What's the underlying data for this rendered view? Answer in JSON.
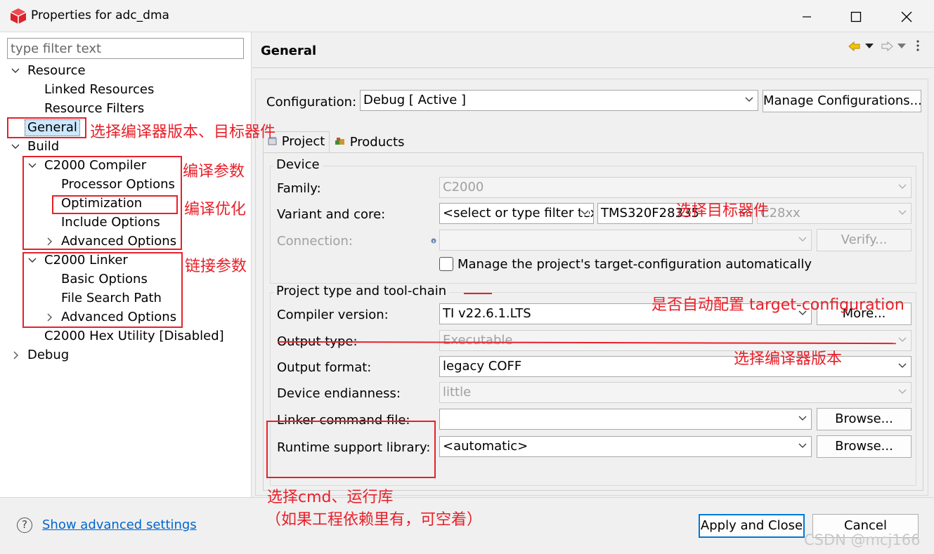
{
  "window": {
    "title": "Properties for adc_dma"
  },
  "filter": {
    "placeholder": "type filter text"
  },
  "tree": {
    "resource": "Resource",
    "linked_resources": "Linked Resources",
    "resource_filters": "Resource Filters",
    "general": "General",
    "build": "Build",
    "c2000_compiler": "C2000 Compiler",
    "processor_options": "Processor Options",
    "optimization": "Optimization",
    "include_options": "Include Options",
    "advanced_options_compiler": "Advanced Options",
    "c2000_linker": "C2000 Linker",
    "basic_options": "Basic Options",
    "file_search_path": "File Search Path",
    "advanced_options_linker": "Advanced Options",
    "hex_utility": "C2000 Hex Utility  [Disabled]",
    "debug": "Debug"
  },
  "page": {
    "title": "General"
  },
  "config": {
    "label": "Configuration:",
    "value": "Debug  [ Active ]",
    "manage_button": "Manage Configurations..."
  },
  "tabs": {
    "project": "Project",
    "products": "Products"
  },
  "device": {
    "group_title": "Device",
    "family_label": "Family:",
    "family_value": "C2000",
    "variant_label": "Variant and core:",
    "variant_filter": "<select or type filter text>",
    "variant_value": "TMS320F28335",
    "core_value": "C28xx",
    "connection_label": "Connection:",
    "verify_button": "Verify...",
    "manage_checkbox": "Manage the project's target-configuration automatically"
  },
  "toolchain": {
    "group_title": "Project type and tool-chain",
    "compiler_label": "Compiler version:",
    "compiler_value": "TI v22.6.1.LTS",
    "more_button": "More...",
    "output_type_label": "Output type:",
    "output_type_value": "Executable",
    "output_format_label": "Output format:",
    "output_format_value": "legacy COFF",
    "endianness_label": "Device endianness:",
    "endianness_value": "little",
    "linker_cmd_label": "Linker command file:",
    "linker_cmd_value": "",
    "browse1": "Browse...",
    "runtime_label": "Runtime support library:",
    "runtime_value": "<automatic>",
    "browse2": "Browse..."
  },
  "bottom": {
    "help_glyph": "?",
    "advanced_link": "Show advanced settings",
    "apply_close": "Apply and Close",
    "cancel": "Cancel",
    "watermark": "CSDN @mcj166"
  },
  "annotations": {
    "general": "选择编译器版本、目标器件",
    "compile_params": "编译参数",
    "optimize": "编译优化",
    "link_params": "链接参数",
    "target_device": "选择目标器件",
    "auto_config": "是否自动配置 target-configuration",
    "compiler_version": "选择编译器版本",
    "cmd_runtime": "选择cmd、运行库",
    "dependency": "（如果工程依赖里有，可空着）"
  },
  "colors": {
    "annotation": "#e8202a",
    "selection": "#cce8ff",
    "link": "#0066cc"
  }
}
